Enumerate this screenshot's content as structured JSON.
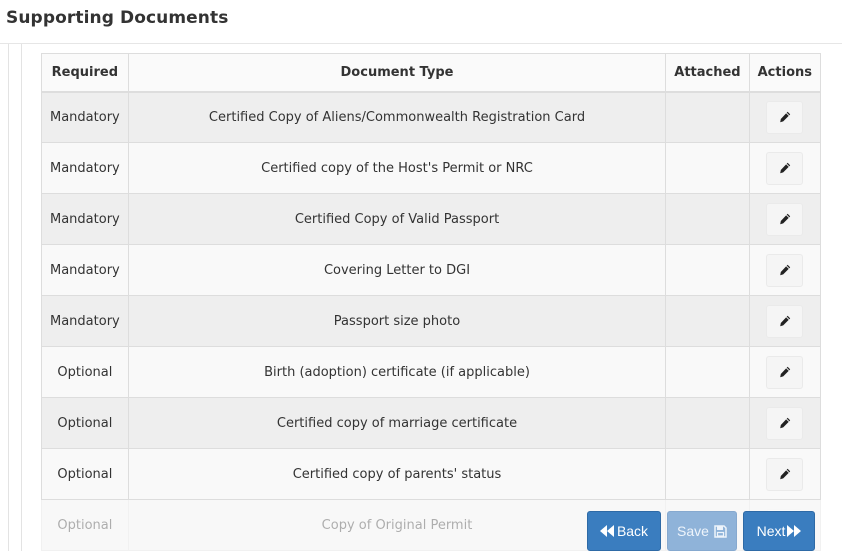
{
  "page": {
    "title": "Supporting Documents"
  },
  "table": {
    "headers": {
      "required": "Required",
      "document_type": "Document Type",
      "attached": "Attached",
      "actions": "Actions"
    },
    "rows": [
      {
        "required": "Mandatory",
        "document_type": "Certified Copy of Aliens/Commonwealth Registration Card",
        "attached": ""
      },
      {
        "required": "Mandatory",
        "document_type": "Certified copy of the Host's Permit or NRC",
        "attached": ""
      },
      {
        "required": "Mandatory",
        "document_type": "Certified Copy of Valid Passport",
        "attached": ""
      },
      {
        "required": "Mandatory",
        "document_type": "Covering Letter to DGI",
        "attached": ""
      },
      {
        "required": "Mandatory",
        "document_type": "Passport size photo",
        "attached": ""
      },
      {
        "required": "Optional",
        "document_type": "Birth (adoption) certificate (if applicable)",
        "attached": ""
      },
      {
        "required": "Optional",
        "document_type": "Certified copy of marriage certificate",
        "attached": ""
      },
      {
        "required": "Optional",
        "document_type": "Certified copy of parents' status",
        "attached": ""
      },
      {
        "required": "Optional",
        "document_type": "Copy of Original Permit",
        "attached": ""
      }
    ],
    "action_icon": "pencil-icon"
  },
  "footer": {
    "back_label": "Back",
    "save_label": "Save",
    "next_label": "Next",
    "back_icon": "double-left-icon",
    "save_icon": "floppy-disk-icon",
    "next_icon": "double-right-icon"
  },
  "colors": {
    "primary_button": "#3a7dbf",
    "disabled_button": "#8fb3d9",
    "row_stripe": "#eeeeee"
  }
}
